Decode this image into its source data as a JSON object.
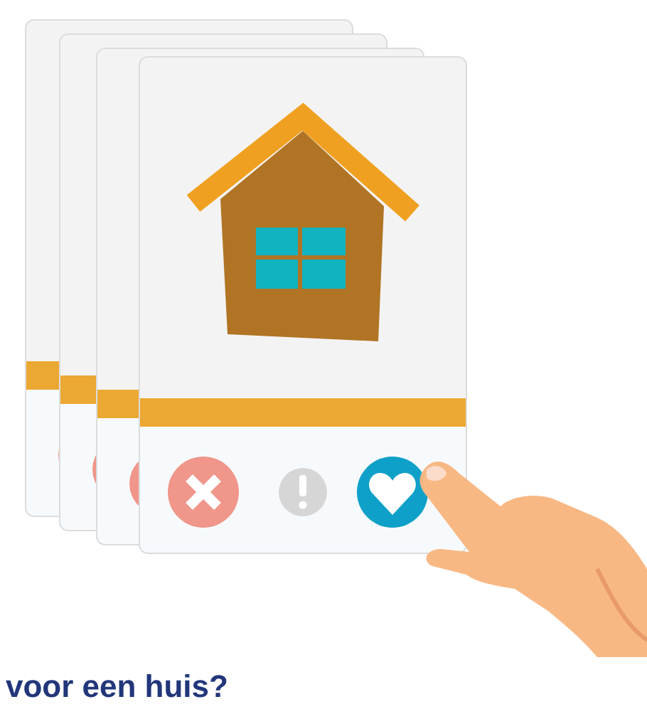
{
  "heading": {
    "text": "voor een huis?"
  }
}
